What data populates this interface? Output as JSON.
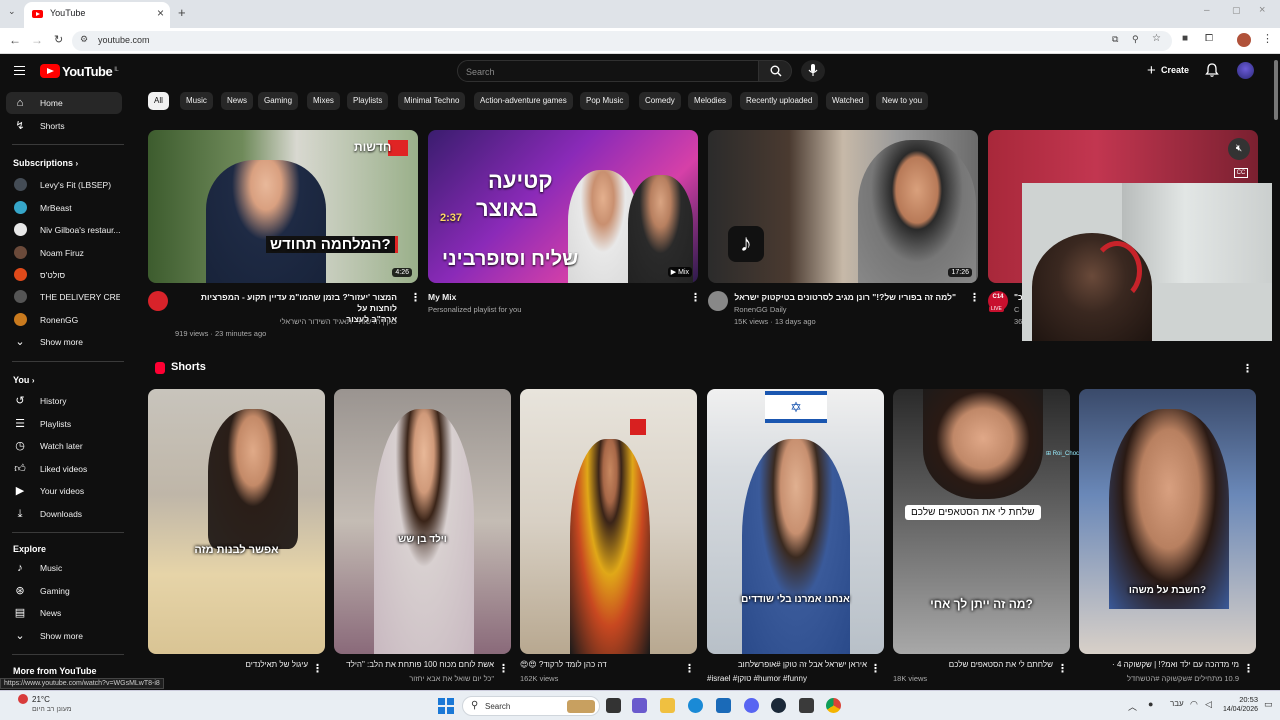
{
  "browser": {
    "tab_title": "YouTube",
    "url": "youtube.com",
    "status_link": "https://www.youtube.com/watch?v=WGsMLwT8-i8"
  },
  "header": {
    "logo_text": "YouTube",
    "logo_region": "IL",
    "search_placeholder": "Search",
    "create_label": "Create"
  },
  "sidebar": {
    "home": "Home",
    "shorts": "Shorts",
    "subscriptions_heading": "Subscriptions",
    "subscriptions": [
      {
        "name": "Levy's Fit (LBSEP)",
        "color": "#444c55"
      },
      {
        "name": "MrBeast",
        "color": "#36a6c9"
      },
      {
        "name": "Niv Gilboa's restaur...",
        "color": "#e8e8e8"
      },
      {
        "name": "Noam Firuz",
        "color": "#6b4a3a"
      },
      {
        "name": "סולט'ס",
        "color": "#e04a1a"
      },
      {
        "name": "THE DELIVERY CRE...",
        "color": "#555"
      },
      {
        "name": "RonenGG",
        "color": "#c97a1e"
      }
    ],
    "show_more": "Show more",
    "you_heading": "You",
    "you_items": [
      "History",
      "Playlists",
      "Watch later",
      "Liked videos",
      "Your videos",
      "Downloads"
    ],
    "explore_heading": "Explore",
    "explore_items": [
      "Music",
      "Gaming",
      "News"
    ],
    "show_more_2": "Show more",
    "more_from": "More from YouTube"
  },
  "chips": [
    "All",
    "Music",
    "News",
    "Gaming",
    "Mixes",
    "Playlists",
    "Minimal Techno",
    "Action-adventure games",
    "Pop Music",
    "Comedy",
    "Melodies",
    "Recently uploaded",
    "Watched",
    "New to you"
  ],
  "videos": [
    {
      "title_line1": "המצור 'יעזור'? בזמן שהמו\"מ עדיין תקוע - המפרציות לוחצות על",
      "title_line2": "ארה\"ב לעצור",
      "channel": "כאן | חדשות - תאגיד השידור הישראלי",
      "meta": "919 views · 23 minutes ago",
      "duration": "4:26",
      "badge": "חדשות",
      "caption": "המלחמה תחודש?"
    },
    {
      "title_line1": "My Mix",
      "title_line2": "",
      "channel": "Personalized playlist for you",
      "meta": "",
      "duration": "Mix",
      "count": "2:37",
      "caption_top": "קטיעה",
      "caption_mid": "באוצר",
      "caption": "שליח וסופרביני"
    },
    {
      "title_line1": "\"למה זה בפוריו של?!\" רונן מגיב לסרטונים בטיקטוק ישראל...",
      "title_line2": "",
      "channel": "RonenGG Daily",
      "meta": "15K views · 13 days ago",
      "duration": "17:26"
    },
    {
      "title_line1": "\"כ",
      "channel": "C",
      "meta": "36",
      "live_badge": "C14",
      "live_label": "LIVE"
    }
  ],
  "shorts_heading": "Shorts",
  "shorts": [
    {
      "caption": "אפשר לבנות מזה",
      "title": "עיגול של תאילנדים",
      "views": "1K views"
    },
    {
      "caption": "וילד בן שש",
      "title": "אשת לוחם מכוח 100 פותחת את הלב: \"הילד",
      "title2": "\"כל יום שואל את אבא יחזור",
      "views": "255 views"
    },
    {
      "caption": "",
      "title": "😍😍 ?דה כהן לומד לרקוד",
      "views": "162K views"
    },
    {
      "caption": "אנחנו אמרנו בלי שודדים",
      "title": "איראן ישראל אבל זה טוקן #אופרשלחוב",
      "title2": "#israel #טוקן #humor #funny",
      "views": "7.4K views"
    },
    {
      "caption": "מה זה ייתן לך אחי?",
      "caption_top": "שלחת לי את הסטאפים שלכם",
      "title": "שלחתם לי את הסטאפים שלכם",
      "views": "18K views",
      "overlay_user": "Roi_Chocron"
    },
    {
      "caption": "חשבת על משהו?",
      "title": "מי מדהכה עם ילד ואמ?! | שקשוקה 4 ·",
      "title2": "10.9 מתחילים #שקשוקה #הטשחדל",
      "views": "27K views"
    }
  ],
  "taskbar": {
    "weather": "21°C",
    "weather_sub": "מעונן רב היום",
    "search": "Search",
    "lang": "עבר",
    "time": "20:53",
    "date": "14/04/2026"
  },
  "colors": {
    "background": "#0f0f0f",
    "chip": "#272727",
    "youtube_red": "#ff0000"
  }
}
